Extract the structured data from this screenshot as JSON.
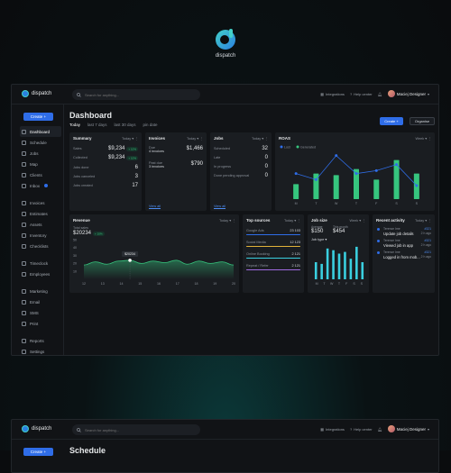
{
  "brand": {
    "name": "dispatch"
  },
  "topbar": {
    "search_placeholder": "Search for anything...",
    "integrations": "Integrations",
    "help": "Help center",
    "user": "Maciej Designer"
  },
  "sidebar": {
    "create": "Create +",
    "groups": [
      [
        {
          "label": "Dashboard",
          "active": true
        },
        {
          "label": "Schedule"
        },
        {
          "label": "Jobs"
        },
        {
          "label": "Map"
        },
        {
          "label": "Clients"
        },
        {
          "label": "Inbox",
          "badge": true
        }
      ],
      [
        {
          "label": "Invoices"
        },
        {
          "label": "Estimates"
        },
        {
          "label": "Assets"
        },
        {
          "label": "Inventory"
        },
        {
          "label": "Checklists"
        }
      ],
      [
        {
          "label": "Timeclock"
        },
        {
          "label": "Employees"
        }
      ],
      [
        {
          "label": "Marketing"
        },
        {
          "label": "Email"
        },
        {
          "label": "SMS"
        },
        {
          "label": "Print"
        }
      ],
      [
        {
          "label": "Reports"
        },
        {
          "label": "Settings"
        }
      ]
    ]
  },
  "page": {
    "title": "Dashboard",
    "ranges": [
      "Today",
      "last 7 days",
      "last 30 days",
      "pin date"
    ],
    "create": "Create +",
    "organise": "Organise"
  },
  "summary": {
    "title": "Summary",
    "ctrl": "Today",
    "rows": [
      {
        "label": "Sales",
        "value": "$9,234",
        "pill": "+ 10%"
      },
      {
        "label": "Collected",
        "value": "$9,234",
        "pill": "+ 10%"
      },
      {
        "label": "Jobs done",
        "value": "6"
      },
      {
        "label": "Jobs canceled",
        "value": "3"
      },
      {
        "label": "Jobs created",
        "value": "17"
      }
    ]
  },
  "invoices": {
    "title": "Invoices",
    "ctrl": "Today",
    "rows": [
      {
        "label": "Due",
        "sub": "4 invoices",
        "value": "$1,466"
      },
      {
        "label": "Past due",
        "sub": "3 invoices",
        "value": "$790"
      }
    ],
    "link": "View all"
  },
  "jobs": {
    "title": "Jobs",
    "ctrl": "Today",
    "rows": [
      {
        "label": "Scheduled",
        "value": "32"
      },
      {
        "label": "Late",
        "value": "0"
      },
      {
        "label": "In progress",
        "value": "0"
      },
      {
        "label": "Done pending approval",
        "value": "0"
      }
    ],
    "link": "View all"
  },
  "roas": {
    "title": "ROAS",
    "ctrl": "Week",
    "legend": [
      "Lost",
      "Generated"
    ]
  },
  "revenue": {
    "title": "Revenue",
    "ctrl": "Today",
    "total_label": "Total sales",
    "total": "$20234",
    "pill": "+ 10%",
    "tooltip": "$20234"
  },
  "top_sources": {
    "title": "Top sources",
    "ctrl": "Today",
    "items": [
      {
        "label": "Google Ads",
        "value": "23 103",
        "color": "#2f6de8"
      },
      {
        "label": "Social Media",
        "value": "12 123",
        "color": "#e0b23a"
      },
      {
        "label": "Online Booking",
        "value": "2 121",
        "color": "#3ad0e0"
      },
      {
        "label": "Repeat / Refer",
        "value": "2 121",
        "color": "#a06ae0"
      }
    ]
  },
  "job_size": {
    "title": "Job size",
    "ctrl": "Week",
    "avg_label": "Average",
    "avg": "$150",
    "top_label": "This month",
    "top": "$454",
    "type": "Job type"
  },
  "activity": {
    "title": "Recent activity",
    "ctrl": "Today",
    "items": [
      {
        "who": "Terence Ime",
        "text": "Update job details",
        "id": "#321",
        "time": "2 h ago"
      },
      {
        "who": "Terence Ime",
        "text": "Viewed job in app",
        "id": "#321",
        "time": "2 h ago"
      },
      {
        "who": "Terence Ime",
        "text": "Logged in from mob...",
        "id": "#321",
        "time": "2 h ago"
      }
    ]
  },
  "second_screen": {
    "title": "Schedule"
  },
  "colors": {
    "accent": "#2f6de8",
    "green": "#36c57e",
    "teal": "#3ad0e0",
    "bg": "#111316",
    "card": "#1a1d21"
  },
  "chart_data": [
    {
      "type": "bar",
      "title": "ROAS",
      "categories": [
        "M",
        "T",
        "W",
        "T",
        "F",
        "S",
        "S"
      ],
      "series": [
        {
          "name": "Lost",
          "type": "line",
          "values": [
            1.7,
            1.3,
            2.9,
            1.7,
            1.9,
            2.3,
            0.9
          ]
        },
        {
          "name": "Generated",
          "type": "bar",
          "values": [
            1.0,
            1.7,
            1.6,
            2.0,
            1.3,
            2.6,
            1.7
          ]
        }
      ],
      "ylim": [
        0,
        3
      ]
    },
    {
      "type": "area",
      "title": "Revenue",
      "x": [
        12,
        13,
        14,
        15,
        16,
        17,
        18,
        19,
        20
      ],
      "values": [
        18,
        22,
        19,
        23,
        24,
        20,
        23,
        21,
        24,
        19,
        23,
        20,
        22,
        18
      ],
      "ylim": [
        0,
        50
      ],
      "yticks": [
        50,
        40,
        30,
        20,
        10
      ]
    },
    {
      "type": "bar",
      "title": "Job size",
      "categories": [
        "M",
        "T",
        "W",
        "T",
        "F",
        "S",
        "S"
      ],
      "values": [
        0.5,
        0.45,
        0.9,
        0.85,
        0.75,
        0.8,
        0.6,
        0.95,
        0.5
      ],
      "ylim": [
        0,
        1
      ]
    }
  ]
}
